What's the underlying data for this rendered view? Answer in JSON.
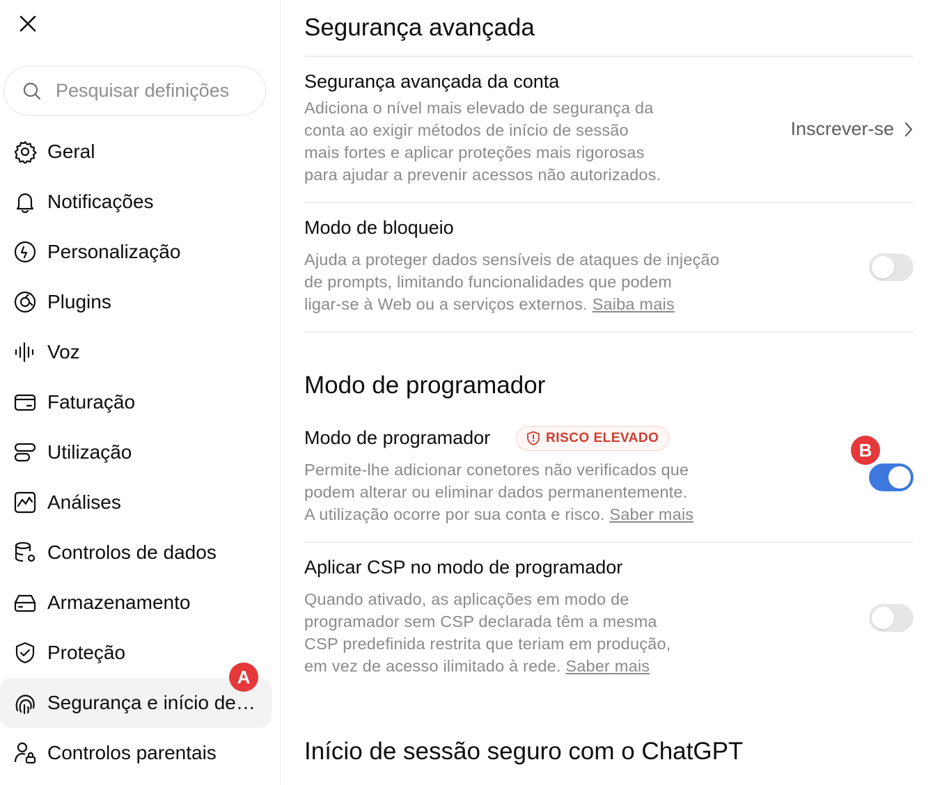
{
  "sidebar": {
    "search_placeholder": "Pesquisar definições",
    "items": [
      {
        "label": "Geral",
        "icon": "gear-icon"
      },
      {
        "label": "Notificações",
        "icon": "bell-icon"
      },
      {
        "label": "Personalização",
        "icon": "personalization-icon"
      },
      {
        "label": "Plugins",
        "icon": "plugins-icon"
      },
      {
        "label": "Voz",
        "icon": "waveform-icon"
      },
      {
        "label": "Faturação",
        "icon": "card-icon"
      },
      {
        "label": "Utilização",
        "icon": "usage-icon"
      },
      {
        "label": "Análises",
        "icon": "analytics-icon"
      },
      {
        "label": "Controlos de dados",
        "icon": "database-gear-icon"
      },
      {
        "label": "Armazenamento",
        "icon": "storage-icon"
      },
      {
        "label": "Proteção",
        "icon": "shield-check-icon"
      },
      {
        "label": "Segurança e início de sessão",
        "icon": "security-login-icon",
        "active": true
      },
      {
        "label": "Controlos parentais",
        "icon": "parental-controls-icon"
      }
    ]
  },
  "markers": {
    "a": "A",
    "b": "B"
  },
  "main": {
    "advanced_security": {
      "title": "Segurança avançada",
      "account_title": "Segurança avançada da conta",
      "account_desc": [
        "Adiciona o nível mais elevado de segurança da",
        "conta ao exigir métodos de início de sessão",
        "mais fortes e aplicar proteções mais rigorosas",
        "para ajudar a prevenir acessos não autorizados."
      ],
      "enroll_label": "Inscrever-se",
      "lockdown_title": "Modo de bloqueio",
      "lockdown_desc": [
        "Ajuda a proteger dados sensíveis de ataques de injeção",
        "de prompts, limitando funcionalidades que podem",
        "ligar-se à Web ou a serviços externos."
      ],
      "lockdown_link": "Saiba mais",
      "lockdown_on": false
    },
    "developer": {
      "title": "Modo de programador",
      "mode_title": "Modo de programador",
      "risk_label": "RISCO ELEVADO",
      "mode_desc": [
        "Permite-lhe adicionar conetores não verificados que",
        "podem alterar ou eliminar dados permanentemente.",
        "A utilização ocorre por sua conta e risco."
      ],
      "mode_link": "Saber mais",
      "mode_on": true,
      "csp_title": "Aplicar CSP no modo de programador",
      "csp_desc": [
        "Quando ativado, as aplicações em modo de",
        "programador sem CSP declarada têm a mesma",
        "CSP predefinida restrita que teriam em produção,",
        "em vez de acesso ilimitado à rede."
      ],
      "csp_link": "Saber mais",
      "csp_on": false
    },
    "secure_login": {
      "title": "Início de sessão seguro com o ChatGPT"
    }
  },
  "colors": {
    "accent": "#3f79e0",
    "risk": "#d23b2f",
    "badge": "#e5383b"
  }
}
